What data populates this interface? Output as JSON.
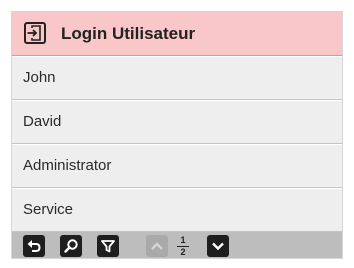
{
  "header": {
    "title": "Login Utilisateur",
    "icon": "login-icon"
  },
  "users": [
    {
      "label": "John"
    },
    {
      "label": "David"
    },
    {
      "label": "Administrator"
    },
    {
      "label": "Service"
    }
  ],
  "toolbar": {
    "buttons": [
      "back-icon",
      "search-icon",
      "filter-icon",
      "chevron-up-icon",
      "chevron-down-icon"
    ],
    "page_current": "1",
    "page_total": "2"
  },
  "colors": {
    "title_bar": "#f9c7c8",
    "list_bg": "#eeeeee",
    "toolbar_bg": "#bdbdbd",
    "button_active": "#1e1e1e",
    "button_disabled": "#a9a9a9"
  }
}
